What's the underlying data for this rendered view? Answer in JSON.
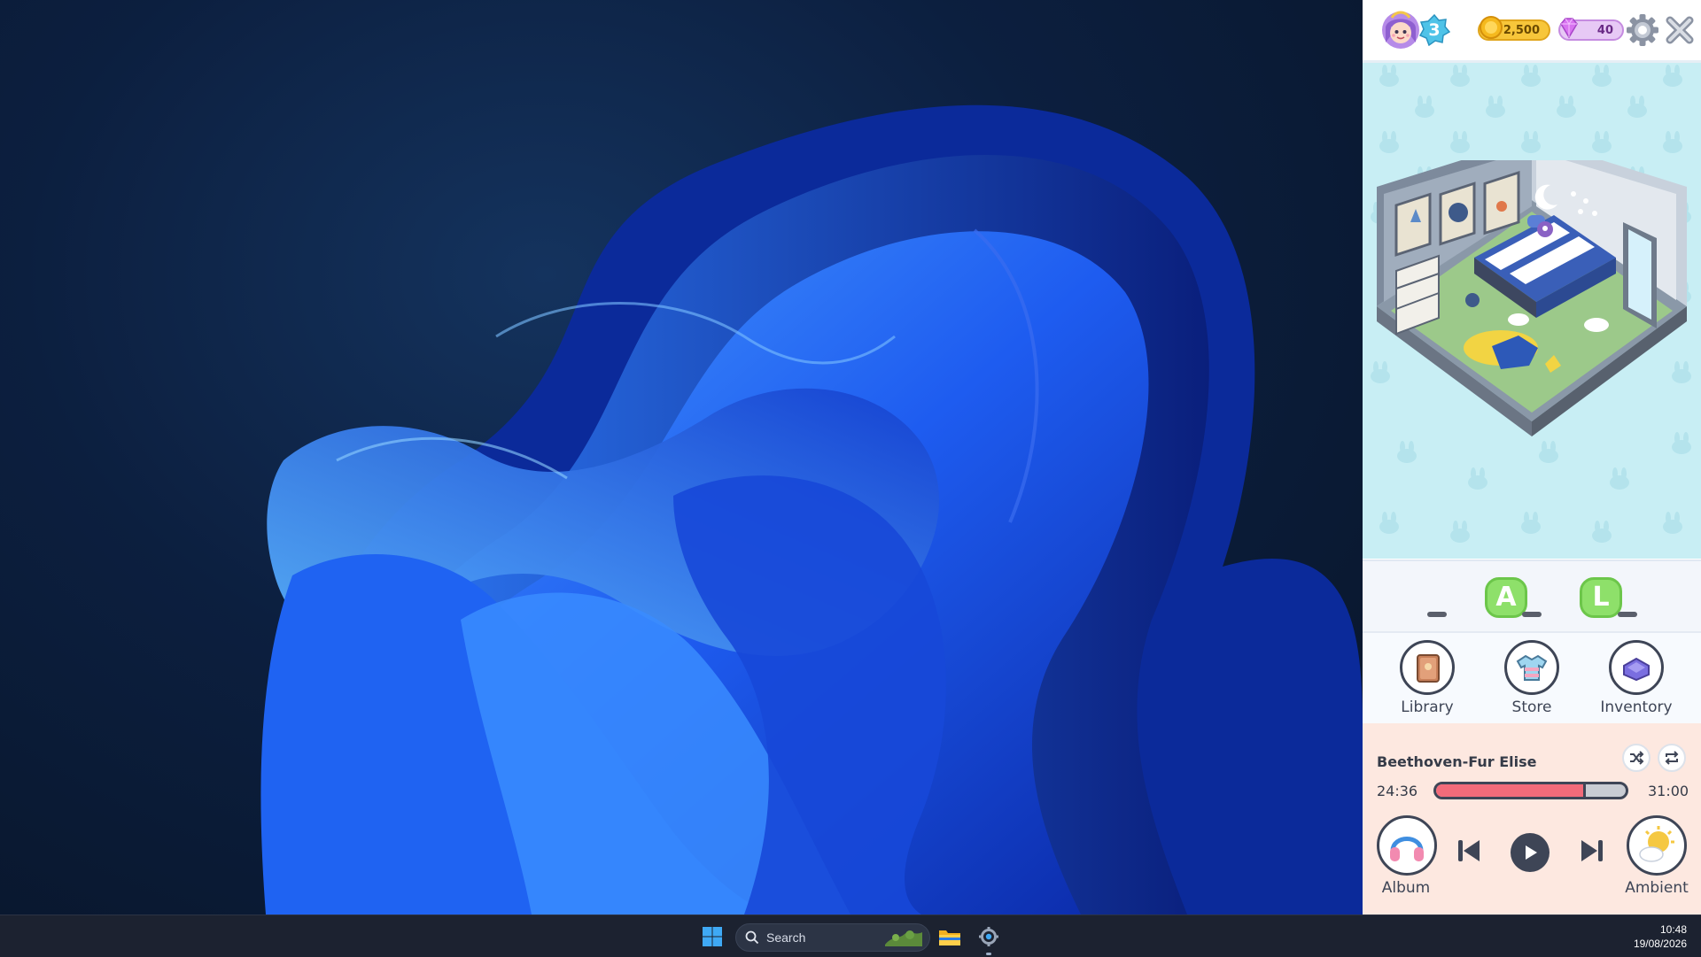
{
  "taskbar": {
    "search_placeholder": "Search",
    "time": "10:48",
    "date": "19/08/2026"
  },
  "game": {
    "player": {
      "level": "3"
    },
    "currency": {
      "coins": "2,500",
      "gems": "40"
    },
    "word": {
      "slots": [
        "_",
        "A",
        "_",
        "L",
        "_"
      ],
      "letter_color": "#8ee06a"
    },
    "nav": {
      "library": "Library",
      "store": "Store",
      "inventory": "Inventory"
    },
    "music": {
      "track_title": "Beethoven-Fur Elise",
      "elapsed": "24:36",
      "duration": "31:00",
      "progress_fraction": 0.79,
      "progress_color": "#f26b7a",
      "album_label": "Album",
      "ambient_label": "Ambient"
    }
  },
  "icons": {
    "windows": "windows-logo-icon",
    "search": "search-icon",
    "explorer": "folder-icon",
    "settings": "gear-icon",
    "close": "close-icon",
    "shuffle": "shuffle-icon",
    "repeat": "repeat-icon",
    "previous": "skip-previous-icon",
    "play": "play-icon",
    "next": "skip-next-icon",
    "headphones": "headphones-icon",
    "weather": "sun-cloud-icon"
  },
  "colors": {
    "wallpaper_primary": "#1b4fe0",
    "room_background": "#c8eef4",
    "player_background": "#fde8e0",
    "coins": "#f7c63a",
    "gems": "#e7c9f5"
  }
}
